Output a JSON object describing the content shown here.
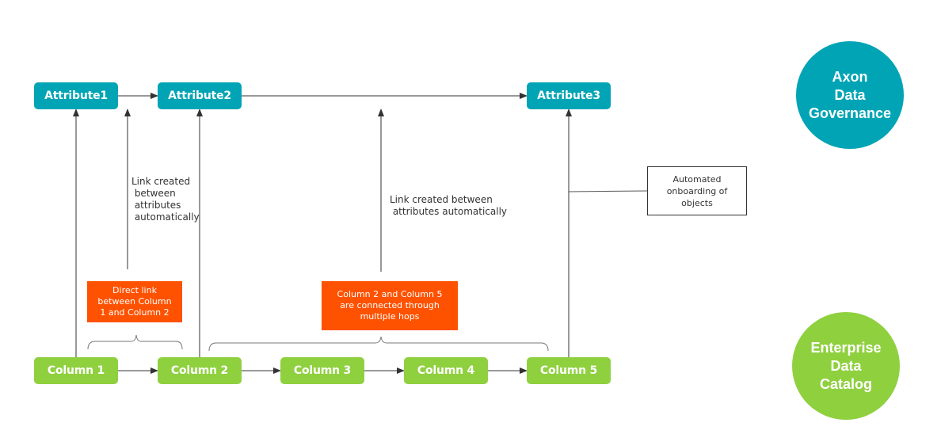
{
  "diagram": {
    "attributes": [
      {
        "id": "attr1",
        "label": "Attribute1"
      },
      {
        "id": "attr2",
        "label": "Attribute2"
      },
      {
        "id": "attr3",
        "label": "Attribute3"
      }
    ],
    "columns": [
      {
        "id": "col1",
        "label": "Column 1"
      },
      {
        "id": "col2",
        "label": "Column 2"
      },
      {
        "id": "col3",
        "label": "Column 3"
      },
      {
        "id": "col4",
        "label": "Column 4"
      },
      {
        "id": "col5",
        "label": "Column 5"
      }
    ],
    "systems": {
      "axon": {
        "label": "Axon\nData\nGovernance",
        "line1": "Axon",
        "line2": "Data",
        "line3": "Governance"
      },
      "edc": {
        "label": "Enterprise\nData\nCatalog",
        "line1": "Enterprise",
        "line2": "Data",
        "line3": "Catalog"
      }
    },
    "annotations": {
      "link_left": "Link created\n between\n attributes\n automatically",
      "link_middle": "Link created between\n attributes automatically",
      "onboarding": "Automated\nonboarding of\nobjects",
      "direct_link": "Direct link\nbetween Column\n1 and Column 2",
      "multi_hop": "Column 2 and Column 5\nare connected through\nmultiple hops"
    },
    "edges": [
      {
        "from": "Attribute1",
        "to": "Attribute2"
      },
      {
        "from": "Attribute2",
        "to": "Attribute3"
      },
      {
        "from": "Column 1",
        "to": "Column 2"
      },
      {
        "from": "Column 2",
        "to": "Column 3"
      },
      {
        "from": "Column 3",
        "to": "Column 4"
      },
      {
        "from": "Column 4",
        "to": "Column 5"
      },
      {
        "from": "Column 1",
        "to": "Attribute1"
      },
      {
        "from": "Column 2",
        "to": "Attribute2"
      },
      {
        "from": "Column 5",
        "to": "Attribute3"
      }
    ],
    "colors": {
      "axon_teal": "#00a4b5",
      "edc_green": "#8fd03f",
      "note_orange": "#ff5200"
    }
  }
}
